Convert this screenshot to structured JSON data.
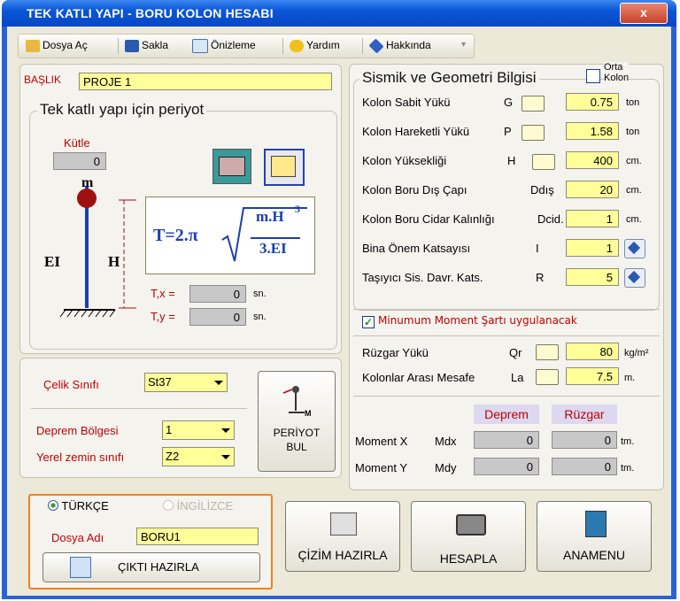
{
  "window": {
    "title": "TEK KATLI YAPI -  BORU KOLON HESABI",
    "close": "x"
  },
  "toolbar": {
    "open": "Dosya Aç",
    "save": "Sakla",
    "preview": "Önizleme",
    "help": "Yardım",
    "about": "Hakkında"
  },
  "header": {
    "label": "BAŞLIK",
    "value": "PROJE 1"
  },
  "period": {
    "group_title": "Tek katlı yapı için periyot",
    "mass_label": "Kütle",
    "mass_value": "0",
    "m": "m",
    "ei": "EI",
    "h": "H",
    "formula_lhs": "T=2.π",
    "formula_num": "m.H",
    "formula_exp": "3",
    "formula_den": "3.EI",
    "tx_label": "T,x =",
    "tx_value": "0",
    "tx_unit": "sn.",
    "ty_label": "T,y =",
    "ty_value": "0",
    "ty_unit": "sn."
  },
  "steel": {
    "steel_label": "Çelik Sınıfı",
    "steel_value": "St37",
    "zone_label": "Deprem Bölgesi",
    "zone_value": "1",
    "soil_label": "Yerel zemin sınıfı",
    "soil_value": "Z2",
    "period_btn_line1": "PERİYOT",
    "period_btn_line2": "BUL",
    "period_btn_m": "M"
  },
  "seismic": {
    "title": "Sismik ve Geometri Bilgisi",
    "orta_1": "Orta",
    "orta_2": "Kolon",
    "rows": [
      {
        "label": "Kolon Sabit Yükü",
        "sym": "G",
        "value": "0.75",
        "unit": "ton"
      },
      {
        "label": "Kolon Hareketli Yükü",
        "sym": "P",
        "value": "1.58",
        "unit": "ton"
      },
      {
        "label": "Kolon Yüksekliği",
        "sym": "H",
        "value": "400",
        "unit": "cm."
      },
      {
        "label": "Kolon Boru  Dış Çapı",
        "sym": "Ddış",
        "value": "20",
        "unit": "cm."
      },
      {
        "label": "Kolon Boru Cidar Kalınlığı",
        "sym": "Dcid.",
        "value": "1",
        "unit": "cm."
      },
      {
        "label": "Bina Önem Katsayısı",
        "sym": "I",
        "value": "1",
        "unit": ""
      },
      {
        "label": "Taşıyıcı Sis.  Davr.  Kats.",
        "sym": "R",
        "value": "5",
        "unit": ""
      }
    ],
    "min_moment": "Minumum Moment Şartı uygulanacak",
    "wind_label": "Rüzgar Yükü",
    "wind_sym": "Qr",
    "wind_value": "80",
    "wind_unit": "kg/m²",
    "dist_label": "Kolonlar Arası Mesafe",
    "dist_sym": "La",
    "dist_value": "7.5",
    "dist_unit": "m.",
    "col_deprem": "Deprem",
    "col_ruzgar": "Rüzgar",
    "mx_label": "Moment X",
    "mx_sym": "Mdx",
    "mx_deprem": "0",
    "mx_ruzgar": "0",
    "mx_unit": "tm.",
    "my_label": "Moment Y",
    "my_sym": "Mdy",
    "my_deprem": "0",
    "my_ruzgar": "0",
    "my_unit": "tm."
  },
  "output": {
    "lang_tr": "TÜRKÇE",
    "lang_en": "İNGİLİZCE",
    "file_label": "Dosya Adı",
    "file_value": "BORU1",
    "prepare": "ÇIKTI HAZIRLA"
  },
  "buttons": {
    "draw": "ÇİZİM HAZIRLA",
    "calc": "HESAPLA",
    "menu": "ANAMENU"
  }
}
